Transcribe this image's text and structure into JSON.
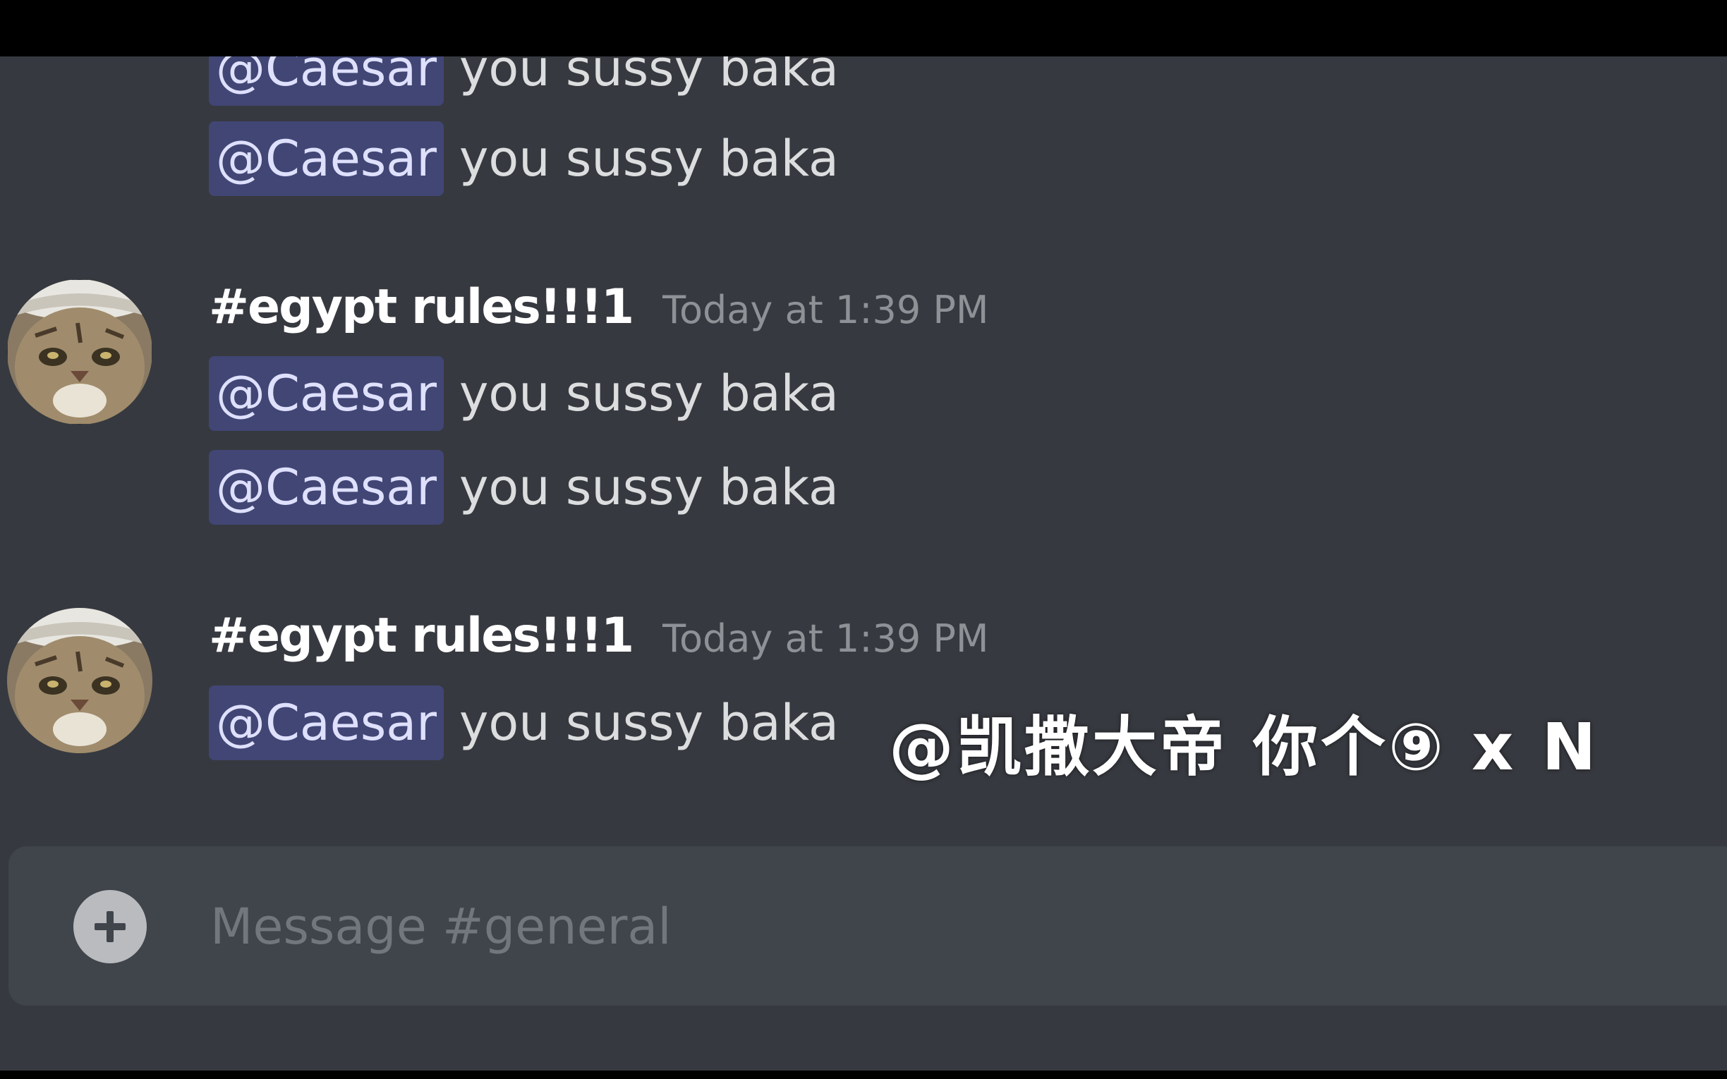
{
  "channel": {
    "name": "general"
  },
  "messages": {
    "top_lines": [
      {
        "mention": "@Caesar",
        "text": "you sussy baka"
      },
      {
        "mention": "@Caesar",
        "text": "you sussy baka"
      }
    ],
    "group1": {
      "username": "#egypt rules!!!1",
      "timestamp": "Today at 1:39 PM",
      "lines": [
        {
          "mention": "@Caesar",
          "text": "you sussy baka"
        },
        {
          "mention": "@Caesar",
          "text": "you sussy baka"
        }
      ]
    },
    "group2": {
      "username": "#egypt rules!!!1",
      "timestamp": "Today at 1:39 PM",
      "lines": [
        {
          "mention": "@Caesar",
          "text": "you sussy baka"
        }
      ]
    }
  },
  "overlay": {
    "caption": "@凯撒大帝 你个⑨ x N"
  },
  "composer": {
    "placeholder": "Message #general",
    "value": ""
  },
  "icons": {
    "add": "plus-circle-icon",
    "avatar": "cat-avatar"
  },
  "colors": {
    "background": "#36393f",
    "mention_bg": "#414675",
    "mention_text": "#dee0fc",
    "username": "#ffffff",
    "timestamp": "#8e9297",
    "composer_bg": "#40444b"
  }
}
